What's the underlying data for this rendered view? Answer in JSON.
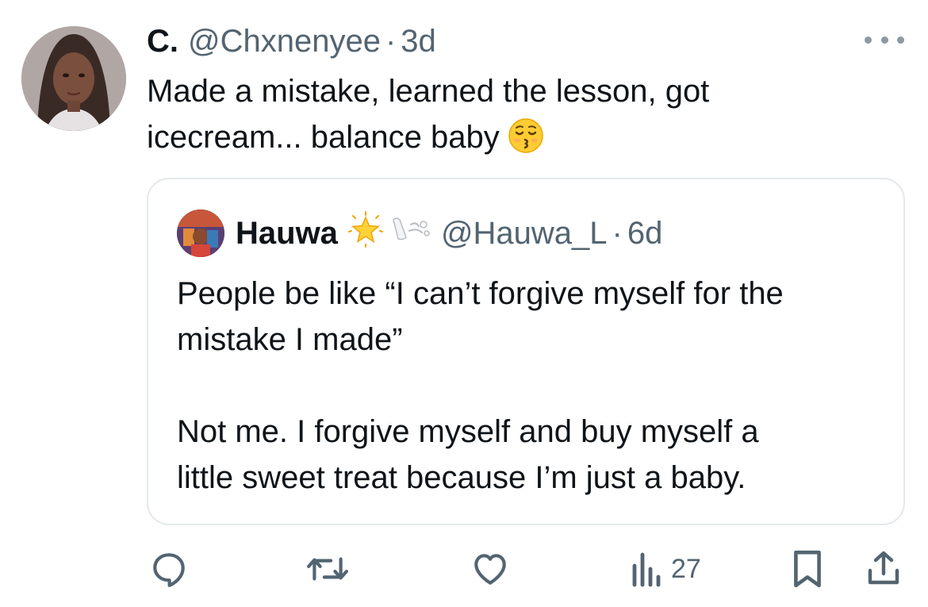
{
  "tweet": {
    "display_name": "C.",
    "handle": "@Chxnenyee",
    "separator": "·",
    "time": "3d",
    "text_line1": "Made a mistake, learned the lesson, got",
    "text_line2": "icecream... balance baby",
    "emoji": "kissing-face-with-closed-eyes"
  },
  "quoted": {
    "display_name": "Hauwa",
    "handle": "@Hauwa_L",
    "separator": "·",
    "time": "6d",
    "paragraph1_line1": "People be like “I can’t forgive myself for the",
    "paragraph1_line2": "mistake I made”",
    "paragraph2_line1": "Not me. I forgive myself and buy myself a",
    "paragraph2_line2": "little sweet treat because I’m just a baby."
  },
  "actions": {
    "views_count": "27",
    "icons": [
      "reply-icon",
      "retweet-icon",
      "like-icon",
      "views-icon",
      "bookmark-icon",
      "share-icon"
    ]
  },
  "colors": {
    "text": "#0f1419",
    "secondary": "#536471",
    "border": "#e4e8eb",
    "icon": "#536471"
  }
}
